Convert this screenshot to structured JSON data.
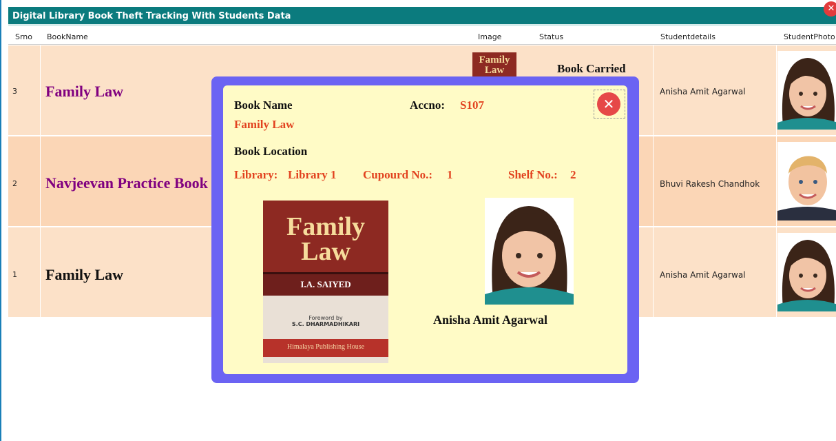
{
  "window": {
    "title": "Digital Library Book Theft Tracking With Students Data",
    "close_glyph": "✕"
  },
  "columns": {
    "srno": "Srno",
    "bookname": "BookName",
    "image": "Image",
    "status": "Status",
    "studentdetails": "Studentdetails",
    "studentphoto": "StudentPhoto"
  },
  "rows": [
    {
      "srno": "3",
      "bookname": "Family Law",
      "color": "#800080",
      "status": "Book Carried",
      "student": "Anisha Amit Agarwal",
      "thumb_title": "Family Law"
    },
    {
      "srno": "2",
      "bookname": "Navjeevan Practice Book",
      "color": "#800080",
      "status": "",
      "student": "Bhuvi Rakesh Chandhok",
      "thumb_title": ""
    },
    {
      "srno": "1",
      "bookname": "Family Law",
      "color": "#111111",
      "status": "",
      "student": "Anisha Amit Agarwal",
      "thumb_title": ""
    }
  ],
  "modal": {
    "book_name_label": "Book Name",
    "book_name": "Family Law",
    "accno_label": "Accno:",
    "accno": "S107",
    "location_label": "Book Location",
    "library_label": "Library:",
    "library": "Library 1",
    "cupboard_label": "Cupourd No.:",
    "cupboard": "1",
    "shelf_label": "Shelf No.:",
    "shelf": "2",
    "close_glyph": "✕",
    "cover": {
      "title_line1": "Family",
      "title_line2": "Law",
      "author": "I.A. SAIYED",
      "foreword": "Foreword by",
      "foreword_name": "S.C. DHARMADHIKARI",
      "publisher": "Himalaya Publishing House"
    },
    "student_name": "Anisha Amit Agarwal"
  },
  "colors": {
    "titlebar": "#0b7b7e",
    "modal_frame": "#6b63f3",
    "modal_bg": "#fffbc6",
    "accent_red": "#e2421f"
  }
}
